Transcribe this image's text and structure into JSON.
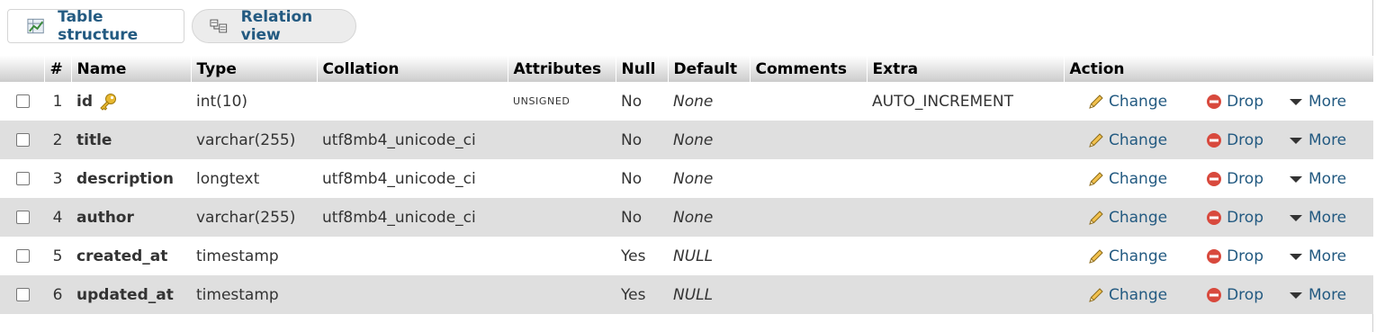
{
  "tabs": {
    "structure_label": "Table structure",
    "relation_label": "Relation view"
  },
  "table": {
    "headers": [
      "#",
      "Name",
      "Type",
      "Collation",
      "Attributes",
      "Null",
      "Default",
      "Comments",
      "Extra",
      "Action"
    ],
    "rows": [
      {
        "num": "1",
        "name": "id",
        "type": "int(10)",
        "collation": "",
        "attributes": "UNSIGNED",
        "null": "No",
        "default": "None",
        "comments": "",
        "extra": "AUTO_INCREMENT",
        "primary_key": true
      },
      {
        "num": "2",
        "name": "title",
        "type": "varchar(255)",
        "collation": "utf8mb4_unicode_ci",
        "attributes": "",
        "null": "No",
        "default": "None",
        "comments": "",
        "extra": ""
      },
      {
        "num": "3",
        "name": "description",
        "type": "longtext",
        "collation": "utf8mb4_unicode_ci",
        "attributes": "",
        "null": "No",
        "default": "None",
        "comments": "",
        "extra": ""
      },
      {
        "num": "4",
        "name": "author",
        "type": "varchar(255)",
        "collation": "utf8mb4_unicode_ci",
        "attributes": "",
        "null": "No",
        "default": "None",
        "comments": "",
        "extra": ""
      },
      {
        "num": "5",
        "name": "created_at",
        "type": "timestamp",
        "collation": "",
        "attributes": "",
        "null": "Yes",
        "default": "NULL",
        "comments": "",
        "extra": ""
      },
      {
        "num": "6",
        "name": "updated_at",
        "type": "timestamp",
        "collation": "",
        "attributes": "",
        "null": "Yes",
        "default": "NULL",
        "comments": "",
        "extra": ""
      }
    ]
  },
  "actions": {
    "change_label": "Change",
    "drop_label": "Drop",
    "more_label": "More"
  },
  "colors": {
    "link": "#235a81",
    "row_even": "#dfdfdf",
    "drop_icon": "#d8493d",
    "key_icon": "#e8b830"
  }
}
